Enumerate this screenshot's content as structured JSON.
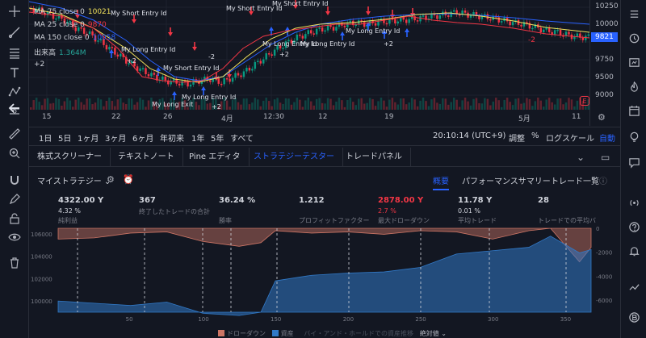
{
  "colors": {
    "bg": "#131722",
    "accent": "#2962ff",
    "red": "#f23645",
    "green": "#089981",
    "ma75": "#f2e25c",
    "ma25": "#f23645",
    "ma150": "#2962ff",
    "drawdown": "#cd7565",
    "equity": "#3179c7"
  },
  "left_tools": [
    "crosshair-icon",
    "trendline-icon",
    "fib-icon",
    "text-icon",
    "pattern-icon",
    "prediction-icon",
    "arrow-left-icon",
    "ruler-icon",
    "zoom-icon",
    "magnet-icon",
    "pencil-lock-icon",
    "lock-icon",
    "eye-icon",
    "trash-icon"
  ],
  "right_tools": [
    "watchlist-icon",
    "alert-icon",
    "data-window-icon",
    "hotlist-icon",
    "calendar-icon",
    "ideas-icon",
    "chat-icon",
    "broadcast-icon",
    "help-icon",
    "notification-icon",
    "streams-icon",
    "crypto-icon"
  ],
  "legend": {
    "ma75_label": "MA 75 close 0",
    "ma75_value": "10021",
    "ma25_label": "MA 25 close 0",
    "ma25_value": "9870",
    "ma150_label": "MA 150 close 0",
    "ma150_value": "10058",
    "volume_label": "出来高",
    "volume_value": "1.364M",
    "collapse_label": "+2"
  },
  "price_axis": {
    "ticks": [
      "10250",
      "10000",
      "9750",
      "9500",
      "9250",
      "9000"
    ],
    "current": "9821"
  },
  "time_axis": [
    "15",
    "22",
    "26",
    "4月",
    "12:30",
    "12",
    "19",
    "5月",
    "11"
  ],
  "signals": {
    "short": "My Short Entry Id",
    "long": "My Long Entry Id",
    "long_exit": "My Long Exit",
    "plus": "+2",
    "minus": "-2",
    "badge": "E"
  },
  "period_bar": {
    "ranges": [
      "1日",
      "5日",
      "1ヶ月",
      "3ヶ月",
      "6ヶ月",
      "年初来",
      "1年",
      "5年",
      "すべて"
    ],
    "time": "20:10:14 (UTC+9)",
    "adjust": "調整",
    "percent": "%",
    "log": "ログスケール",
    "auto": "自動"
  },
  "tabs": [
    "株式スクリーナー",
    "テキストノート",
    "Pine エディタ",
    "ストラテジーテスター",
    "トレードパネル"
  ],
  "strategy": {
    "name": "マイストラテジー ⌄",
    "subtabs": [
      "概要",
      "パフォーマンスサマリー",
      "トレード一覧"
    ]
  },
  "metrics": [
    {
      "value": "4322.00 Y",
      "sub": "4.32 %",
      "label": "純利益",
      "red": false
    },
    {
      "value": "367",
      "sub": "",
      "label": "終了したトレードの合計",
      "red": false
    },
    {
      "value": "36.24 %",
      "sub": "",
      "label": "勝率",
      "red": false
    },
    {
      "value": "1.212",
      "sub": "",
      "label": "プロフィットファクター",
      "red": false
    },
    {
      "value": "2878.00 Y",
      "sub": "2.7 %",
      "label": "最大ドローダウン",
      "red": true
    },
    {
      "value": "11.78 Y",
      "sub": "0.01 %",
      "label": "平均トレード",
      "red": false
    },
    {
      "value": "28",
      "sub": "",
      "label": "トレードでの平均バ",
      "red": false
    }
  ],
  "equity_chart": {
    "left_ticks": [
      "106000",
      "104000",
      "102000",
      "100000"
    ],
    "right_ticks": [
      "0",
      "-2000",
      "-4000",
      "-6000"
    ],
    "x_ticks": [
      "50",
      "100",
      "150",
      "200",
      "250",
      "300",
      "350"
    ],
    "legend_drawdown": "ドローダウン",
    "legend_equity": "資産",
    "legend_bh": "バイ・アンド・ホールドでの資産推移",
    "legend_abs": "絶対値 ⌄"
  },
  "chart_data": {
    "type": "area",
    "title": "",
    "x": [
      0,
      25,
      50,
      75,
      100,
      125,
      140,
      150,
      175,
      200,
      225,
      250,
      275,
      300,
      325,
      340,
      360,
      368
    ],
    "series": [
      {
        "name": "資産",
        "values": [
          100000,
          99800,
          99600,
          99900,
          98900,
          98700,
          99000,
          101800,
          102300,
          102500,
          102600,
          103000,
          104200,
          104500,
          104800,
          105800,
          104300,
          104600
        ]
      },
      {
        "name": "ドローダウン",
        "values": [
          -900,
          -800,
          -400,
          -300,
          -1100,
          -1500,
          -1200,
          -200,
          -400,
          -300,
          -500,
          -200,
          -300,
          -900,
          -200,
          0,
          -2800,
          -1600
        ]
      }
    ],
    "ylim": [
      99000,
      106500
    ],
    "y2lim": [
      -7000,
      0
    ]
  }
}
